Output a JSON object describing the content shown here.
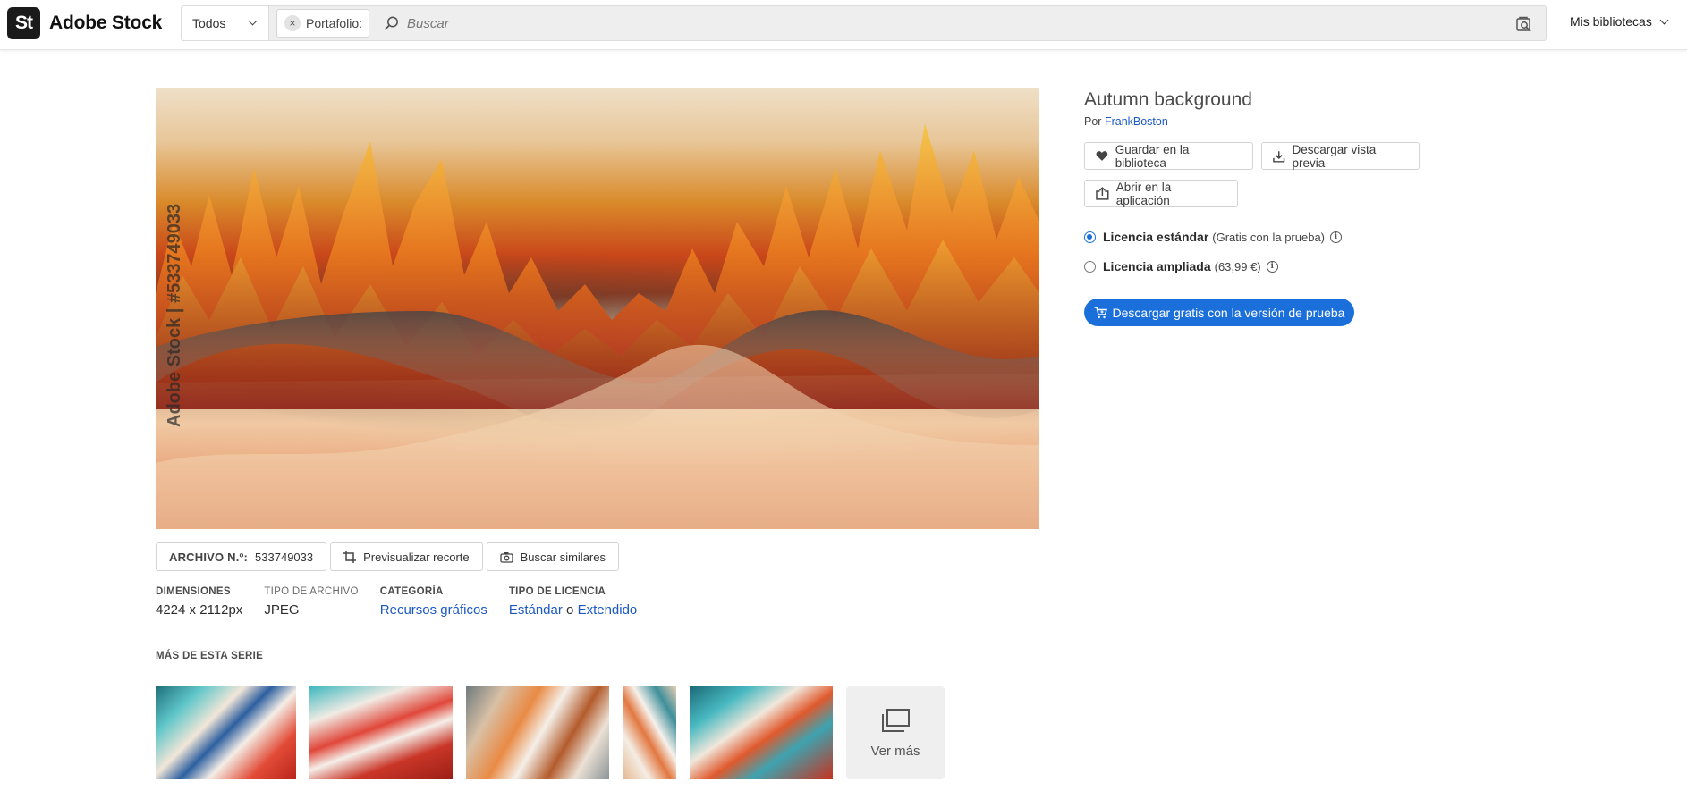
{
  "brand": {
    "badge": "St",
    "name": "Adobe Stock"
  },
  "search": {
    "scope": "Todos",
    "chip_close": "×",
    "chip_label": "Portafolio:",
    "placeholder": "Buscar"
  },
  "header": {
    "libraries": "Mis bibliotecas"
  },
  "image": {
    "watermark": "Adobe Stock | #533749033",
    "file_label": "ARCHIVO N.º:",
    "file_number": "533749033",
    "crop_preview": "Previsualizar recorte",
    "find_similar": "Buscar similares"
  },
  "meta": {
    "dimensions_h": "DIMENSIONES",
    "dimensions_v": "4224 x 2112px",
    "filetype_h": "TIPO DE ARCHIVO",
    "filetype_v": "JPEG",
    "category_h": "CATEGORÍA",
    "category_v": "Recursos gráficos",
    "license_h": "TIPO DE LICENCIA",
    "license_standard": "Estándar",
    "license_or": " o ",
    "license_extended": "Extendido"
  },
  "series": {
    "title": "MÁS DE ESTA SERIE",
    "see_more": "Ver más"
  },
  "asset": {
    "title": "Autumn background",
    "by": "Por ",
    "author": "FrankBoston"
  },
  "actions": {
    "save": "Guardar en la biblioteca",
    "download_preview": "Descargar vista previa",
    "open_app": "Abrir en la aplicación"
  },
  "licenses": {
    "standard_name": "Licencia estándar",
    "standard_note": "(Gratis con la prueba)",
    "extended_name": "Licencia ampliada",
    "extended_note": "(63,99 €)",
    "info_glyph": "i",
    "selected": "standard"
  },
  "cta": {
    "label": "Descargar gratis con la versión de prueba"
  },
  "colors": {
    "accent": "#1b6fdb",
    "link": "#1b58c4"
  }
}
